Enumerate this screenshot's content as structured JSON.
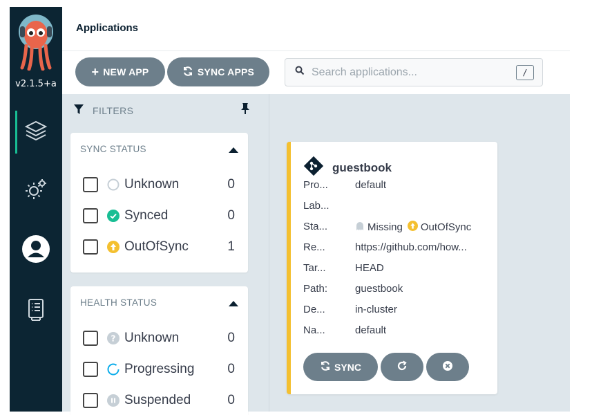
{
  "sidebar": {
    "version": "v2.1.5+a",
    "items": [
      {
        "icon": "applications-stack-icon"
      },
      {
        "icon": "settings-gears-icon"
      },
      {
        "icon": "user-icon"
      },
      {
        "icon": "docs-icon"
      }
    ]
  },
  "header": {
    "title": "Applications"
  },
  "toolbar": {
    "new_app_label": "NEW APP",
    "sync_apps_label": "SYNC APPS",
    "search_placeholder": "Search applications...",
    "search_value": "",
    "search_shortcut": "/"
  },
  "filters": {
    "heading": "FILTERS",
    "sync_status": {
      "title": "SYNC STATUS",
      "items": [
        {
          "label": "Unknown",
          "count": "0"
        },
        {
          "label": "Synced",
          "count": "0"
        },
        {
          "label": "OutOfSync",
          "count": "1"
        }
      ]
    },
    "health_status": {
      "title": "HEALTH STATUS",
      "items": [
        {
          "label": "Unknown",
          "count": "0"
        },
        {
          "label": "Progressing",
          "count": "0"
        },
        {
          "label": "Suspended",
          "count": "0"
        }
      ]
    }
  },
  "app_card": {
    "name": "guestbook",
    "fields": [
      {
        "label": "Pro...",
        "value": "default"
      },
      {
        "label": "Lab...",
        "value": ""
      },
      {
        "label": "Sta...",
        "value": ""
      },
      {
        "label": "Re...",
        "value": "https://github.com/how..."
      },
      {
        "label": "Tar...",
        "value": "HEAD"
      },
      {
        "label": "Path:",
        "value": "guestbook"
      },
      {
        "label": "De...",
        "value": "in-cluster"
      },
      {
        "label": "Na...",
        "value": "default"
      }
    ],
    "health": "Missing",
    "sync": "OutOfSync",
    "sync_button_label": "SYNC"
  },
  "colors": {
    "sidebar_bg": "#0c2533",
    "accent_green": "#18be94",
    "button_gray": "#6d7f8b",
    "outofsync_yellow": "#f4c030",
    "content_bg": "#dee6eb"
  }
}
